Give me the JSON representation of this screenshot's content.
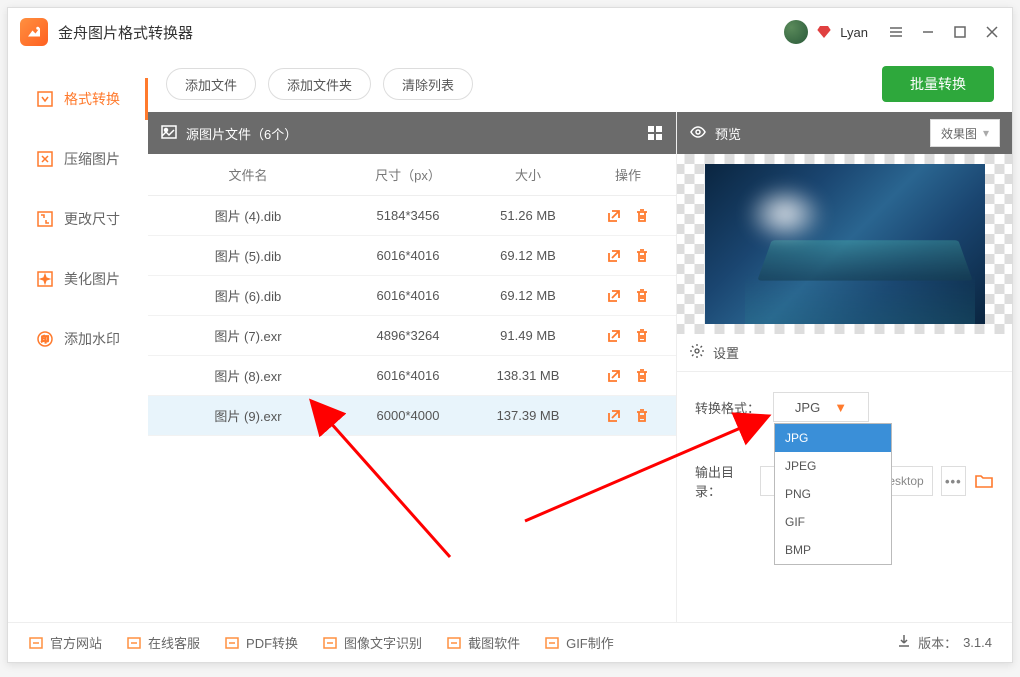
{
  "app_title": "金舟图片格式转换器",
  "user": {
    "name": "Lyan"
  },
  "sidebar": {
    "items": [
      {
        "label": "格式转换",
        "icon": "format-convert-icon",
        "active": true
      },
      {
        "label": "压缩图片",
        "icon": "compress-icon",
        "active": false
      },
      {
        "label": "更改尺寸",
        "icon": "resize-icon",
        "active": false
      },
      {
        "label": "美化图片",
        "icon": "beautify-icon",
        "active": false
      },
      {
        "label": "添加水印",
        "icon": "watermark-icon",
        "active": false
      }
    ]
  },
  "toolbar": {
    "add_file": "添加文件",
    "add_folder": "添加文件夹",
    "clear_list": "清除列表",
    "batch_convert": "批量转换"
  },
  "table": {
    "header_title": "源图片文件（6个）",
    "columns": {
      "name": "文件名",
      "dimensions": "尺寸（px）",
      "size": "大小",
      "actions": "操作"
    },
    "rows": [
      {
        "name": "图片 (4).dib",
        "dim": "5184*3456",
        "size": "51.26 MB",
        "selected": false
      },
      {
        "name": "图片 (5).dib",
        "dim": "6016*4016",
        "size": "69.12 MB",
        "selected": false
      },
      {
        "name": "图片 (6).dib",
        "dim": "6016*4016",
        "size": "69.12 MB",
        "selected": false
      },
      {
        "name": "图片 (7).exr",
        "dim": "4896*3264",
        "size": "91.49 MB",
        "selected": false
      },
      {
        "name": "图片 (8).exr",
        "dim": "6016*4016",
        "size": "138.31 MB",
        "selected": false
      },
      {
        "name": "图片 (9).exr",
        "dim": "6000*4000",
        "size": "137.39 MB",
        "selected": true
      }
    ]
  },
  "preview": {
    "title": "预览",
    "mode_label": "效果图"
  },
  "settings": {
    "title": "设置",
    "format_label": "转换格式：",
    "format_selected": "JPG",
    "format_options": [
      "JPG",
      "JPEG",
      "PNG",
      "GIF",
      "BMP"
    ],
    "output_label": "输出目录：",
    "output_path": "n\\Desktop",
    "more": "•••"
  },
  "footer": {
    "links": [
      {
        "label": "官方网站",
        "icon": "website-icon"
      },
      {
        "label": "在线客服",
        "icon": "support-icon"
      },
      {
        "label": "PDF转换",
        "icon": "pdf-icon"
      },
      {
        "label": "图像文字识别",
        "icon": "ocr-icon"
      },
      {
        "label": "截图软件",
        "icon": "screenshot-icon"
      },
      {
        "label": "GIF制作",
        "icon": "gif-icon"
      }
    ],
    "version_label": "版本：",
    "version": "3.1.4"
  }
}
